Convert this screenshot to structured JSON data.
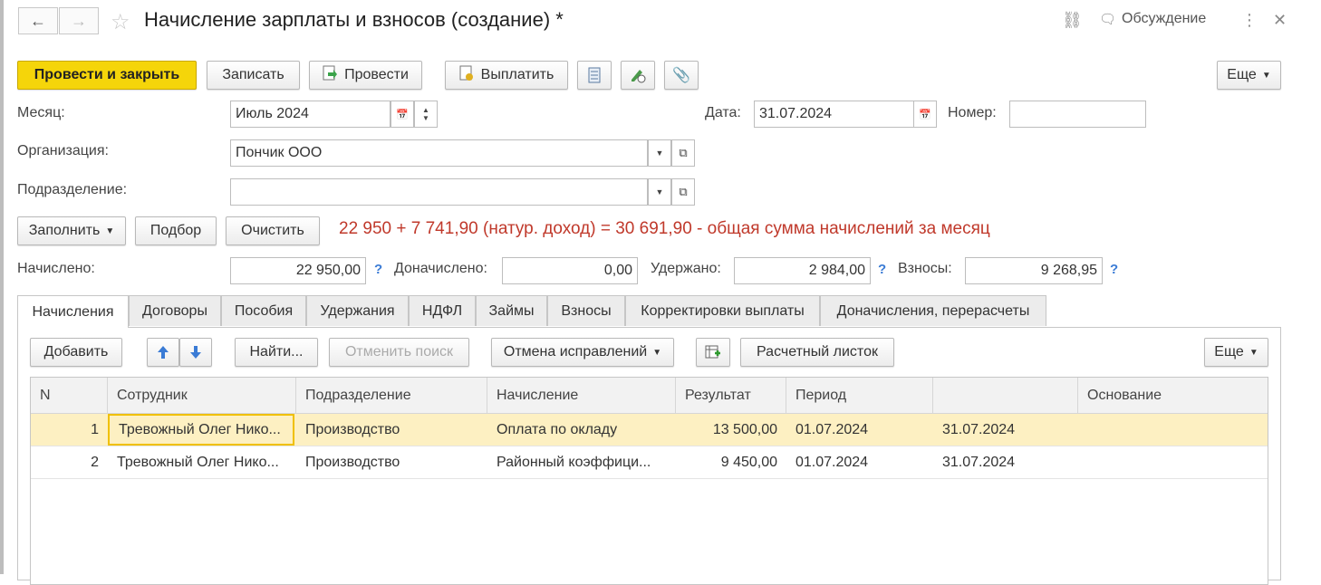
{
  "window": {
    "title": "Начисление зарплаты и взносов (создание) *",
    "back_icon": "←",
    "forward_icon": "→",
    "star_icon": "☆",
    "link_icon": "⛓",
    "discussion_icon": "🗨",
    "discussion_label": "Обсуждение",
    "more_icon": "⋮",
    "close_icon": "✕"
  },
  "toolbar": {
    "post_close": "Провести и закрыть",
    "save": "Записать",
    "post": "Провести",
    "pay": "Выплатить",
    "more": "Еще"
  },
  "form": {
    "month_label": "Месяц:",
    "month_value": "Июль 2024",
    "date_label": "Дата:",
    "date_value": "31.07.2024",
    "number_label": "Номер:",
    "number_value": "",
    "org_label": "Организация:",
    "org_value": "Пончик ООО",
    "dept_label": "Подразделение:",
    "dept_value": ""
  },
  "actions": {
    "fill": "Заполнить",
    "select": "Подбор",
    "clear": "Очистить",
    "note": "22 950 + 7 741,90 (натур. доход) = 30 691,90 - общая сумма начислений за месяц"
  },
  "totals": {
    "accrued_label": "Начислено:",
    "accrued_value": "22 950,00",
    "additional_label": "Доначислено:",
    "additional_value": "0,00",
    "withheld_label": "Удержано:",
    "withheld_value": "2 984,00",
    "contributions_label": "Взносы:",
    "contributions_value": "9 268,95",
    "help_mark": "?"
  },
  "tabs": [
    "Начисления",
    "Договоры",
    "Пособия",
    "Удержания",
    "НДФЛ",
    "Займы",
    "Взносы",
    "Корректировки выплаты",
    "Доначисления, перерасчеты"
  ],
  "grid_toolbar": {
    "add": "Добавить",
    "find": "Найти...",
    "cancel_search": "Отменить поиск",
    "undo_fix": "Отмена исправлений",
    "payslip": "Расчетный листок",
    "more": "Еще"
  },
  "table": {
    "columns": [
      "N",
      "Сотрудник",
      "Подразделение",
      "Начисление",
      "Результат",
      "Период",
      "",
      "Основание"
    ],
    "rows": [
      [
        "1",
        "Тревожный Олег Нико...",
        "Производство",
        "Оплата по окладу",
        "13 500,00",
        "01.07.2024",
        "31.07.2024",
        ""
      ],
      [
        "2",
        "Тревожный Олег Нико...",
        "Производство",
        "Районный коэффици...",
        "9 450,00",
        "01.07.2024",
        "31.07.2024",
        ""
      ]
    ]
  },
  "colors": {
    "primary": "#f5d50a",
    "note_red": "#c0392b",
    "help_blue": "#3a7bd5",
    "selected_row": "#fdf0c2",
    "arrow_blue": "#3a7bd5"
  }
}
